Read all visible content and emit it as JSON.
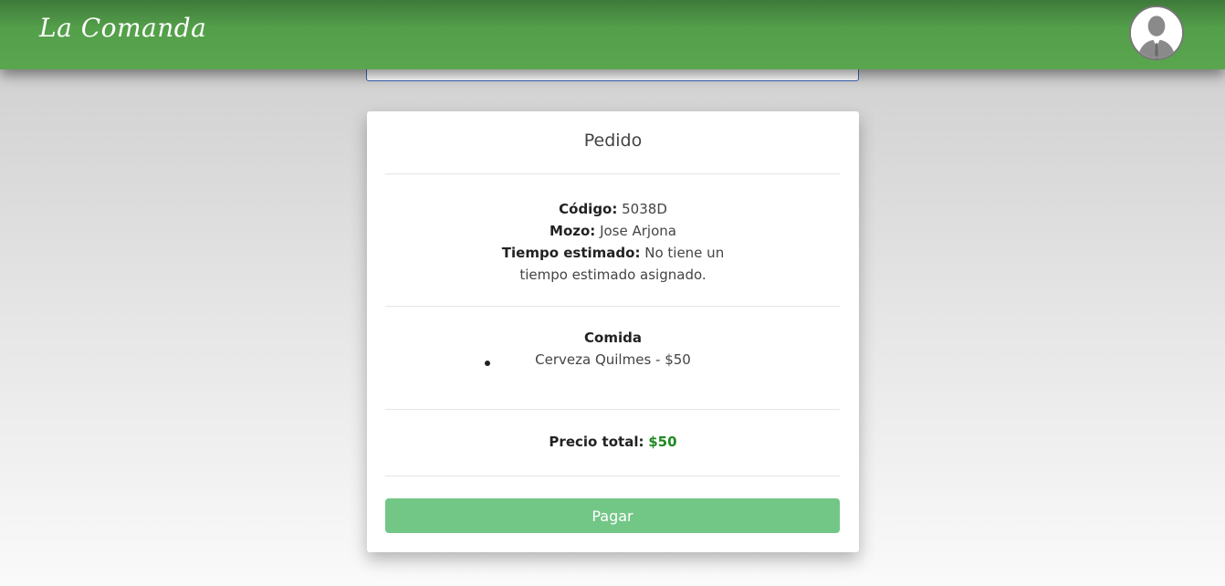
{
  "header": {
    "brand": "La Comanda",
    "avatar_icon": "user-avatar-icon"
  },
  "order": {
    "title": "Pedido",
    "code_label": "Código:",
    "code_value": "5038D",
    "waiter_label": "Mozo:",
    "waiter_value": "Jose Arjona",
    "time_label": "Tiempo estimado:",
    "time_value": "No tiene un tiempo estimado asignado.",
    "food_title": "Comida",
    "food_items": [
      "Cerveza Quilmes - $50"
    ],
    "total_label": "Precio total:",
    "total_value": "$50",
    "pay_label": "Pagar"
  },
  "colors": {
    "navbar": "#549f4a",
    "pay_button": "#72c686",
    "price": "#1f8a1f",
    "prev_card_border": "#3a64b8"
  }
}
